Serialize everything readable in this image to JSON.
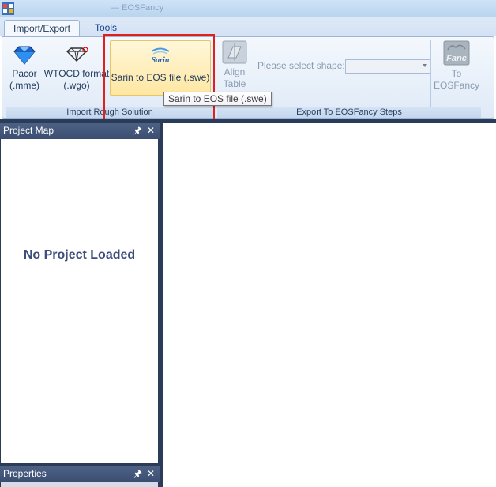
{
  "window": {
    "title": "— EOSFancy"
  },
  "tabs": [
    {
      "label": "Import/Export",
      "active": true
    },
    {
      "label": "Tools",
      "active": false
    }
  ],
  "ribbon": {
    "group_import": {
      "label": "Import Rough Solution",
      "buttons": [
        {
          "line1": "Pacor",
          "line2": "(.mme)",
          "icon": "diamond-icon"
        },
        {
          "line1": "WTOCD format",
          "line2": "(.wgo)",
          "icon": "wtocd-icon"
        },
        {
          "line1": "Sarin to EOS file (.swe)",
          "icon": "sarin-logo-icon"
        }
      ]
    },
    "group_export": {
      "label": "Export To EOSFancy Steps",
      "align_button": {
        "line1": "Align",
        "line2": "Table",
        "icon": "align-table-icon"
      },
      "shape_label": "Please select  shape:",
      "shape_value": "",
      "to_eosfancy": {
        "line1": "To",
        "line2": "EOSFancy",
        "icon": "eosfancy-icon"
      }
    }
  },
  "tooltip": {
    "text": "Sarin to EOS file (.swe)"
  },
  "project_map": {
    "title": "Project Map",
    "pin": "Ὄc",
    "close": "✕",
    "empty_text": "No Project Loaded"
  },
  "properties": {
    "title": "Properties"
  },
  "colors": {
    "highlight": "#e0201c",
    "panel_header": "#3b4e70",
    "frame": "#2b3c59"
  }
}
